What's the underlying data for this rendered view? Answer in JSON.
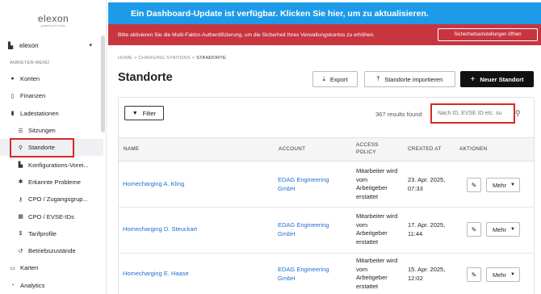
{
  "brand": {
    "name": "elexon",
    "tagline": "powering the future"
  },
  "org": {
    "name": "elexon",
    "icon": "building-icon",
    "caret": "▾"
  },
  "sidebar": {
    "section_label": "ANBIETER-MENÜ",
    "items": [
      {
        "label": "Konten",
        "icon": "user-icon",
        "glyph": "●"
      },
      {
        "label": "Finanzen",
        "icon": "file-icon",
        "glyph": "▯"
      },
      {
        "label": "Ladestationen",
        "icon": "charging-station-icon",
        "glyph": "▮"
      },
      {
        "label": "Sitzungen",
        "icon": "list-icon",
        "glyph": "☰"
      },
      {
        "label": "Standorte",
        "icon": "map-pin-icon",
        "glyph": "⚲"
      },
      {
        "label": "Konfigurations-Vorei...",
        "icon": "config-icon",
        "glyph": "▙"
      },
      {
        "label": "Erkannte Probleme",
        "icon": "bug-icon",
        "glyph": "✱"
      },
      {
        "label": "CPO / Zugangsgrup...",
        "icon": "key-icon",
        "glyph": "⚷"
      },
      {
        "label": "CPO / EVSE-IDs",
        "icon": "grid-icon",
        "glyph": "▦"
      },
      {
        "label": "Tarifprofile",
        "icon": "dollar-icon",
        "glyph": "$"
      },
      {
        "label": "Betriebszustände",
        "icon": "history-icon",
        "glyph": "↺"
      },
      {
        "label": "Karten",
        "icon": "card-icon",
        "glyph": "▭"
      },
      {
        "label": "Analytics",
        "icon": "chart-icon",
        "glyph": "◔"
      }
    ]
  },
  "banners": {
    "update": "Ein Dashboard-Update ist verfügbar. Klicken Sie hier, um zu aktualisieren.",
    "mfa": "Bitte aktivieren Sie die Multi-Faktor-Authentifizierung, um die Sicherheit Ihres Verwaltungskontos zu erhöhen.",
    "mfa_button": "Sicherheitseinstellungen öffnen"
  },
  "breadcrumb": {
    "home": "HOME",
    "sep": ">",
    "section": "CHARGING STATIONS",
    "current": "STANDORTE"
  },
  "page": {
    "title": "Standorte",
    "export_label": "Export",
    "import_label": "Standorte importieren",
    "new_label": "Neuer Standort",
    "filter_label": "Filter",
    "results_text": "367 results found",
    "search_placeholder": "Nach ID, EVSE ID etc. su"
  },
  "table": {
    "columns": [
      "NAME",
      "ACCOUNT",
      "ACCESS\nPOLICY",
      "CREATED AT",
      "AKTIONEN"
    ],
    "rows": [
      {
        "name": "Homecharging A. Kling",
        "account": "EDAG Engineering GmbH",
        "policy": "Mitarbeiter wird vom Arbeitgeber erstattet",
        "created": "23. Apr. 2025, 07:33",
        "more": "Mehr"
      },
      {
        "name": "Homecharging D. Steuckart",
        "account": "EDAG Engineering GmbH",
        "policy": "Mitarbeiter wird vom Arbeitgeber erstattet",
        "created": "17. Apr. 2025, 11:44",
        "more": "Mehr"
      },
      {
        "name": "Homecharging E. Haase",
        "account": "EDAG Engineering GmbH",
        "policy": "Mitarbeiter wird vom Arbeitgeber erstattet",
        "created": "15. Apr. 2025, 12:02",
        "more": "Mehr"
      }
    ]
  },
  "colors": {
    "accent_blue": "#1e9be8",
    "alert_red": "#c8353f",
    "link": "#1f6fcf",
    "highlight": "#d62828"
  }
}
